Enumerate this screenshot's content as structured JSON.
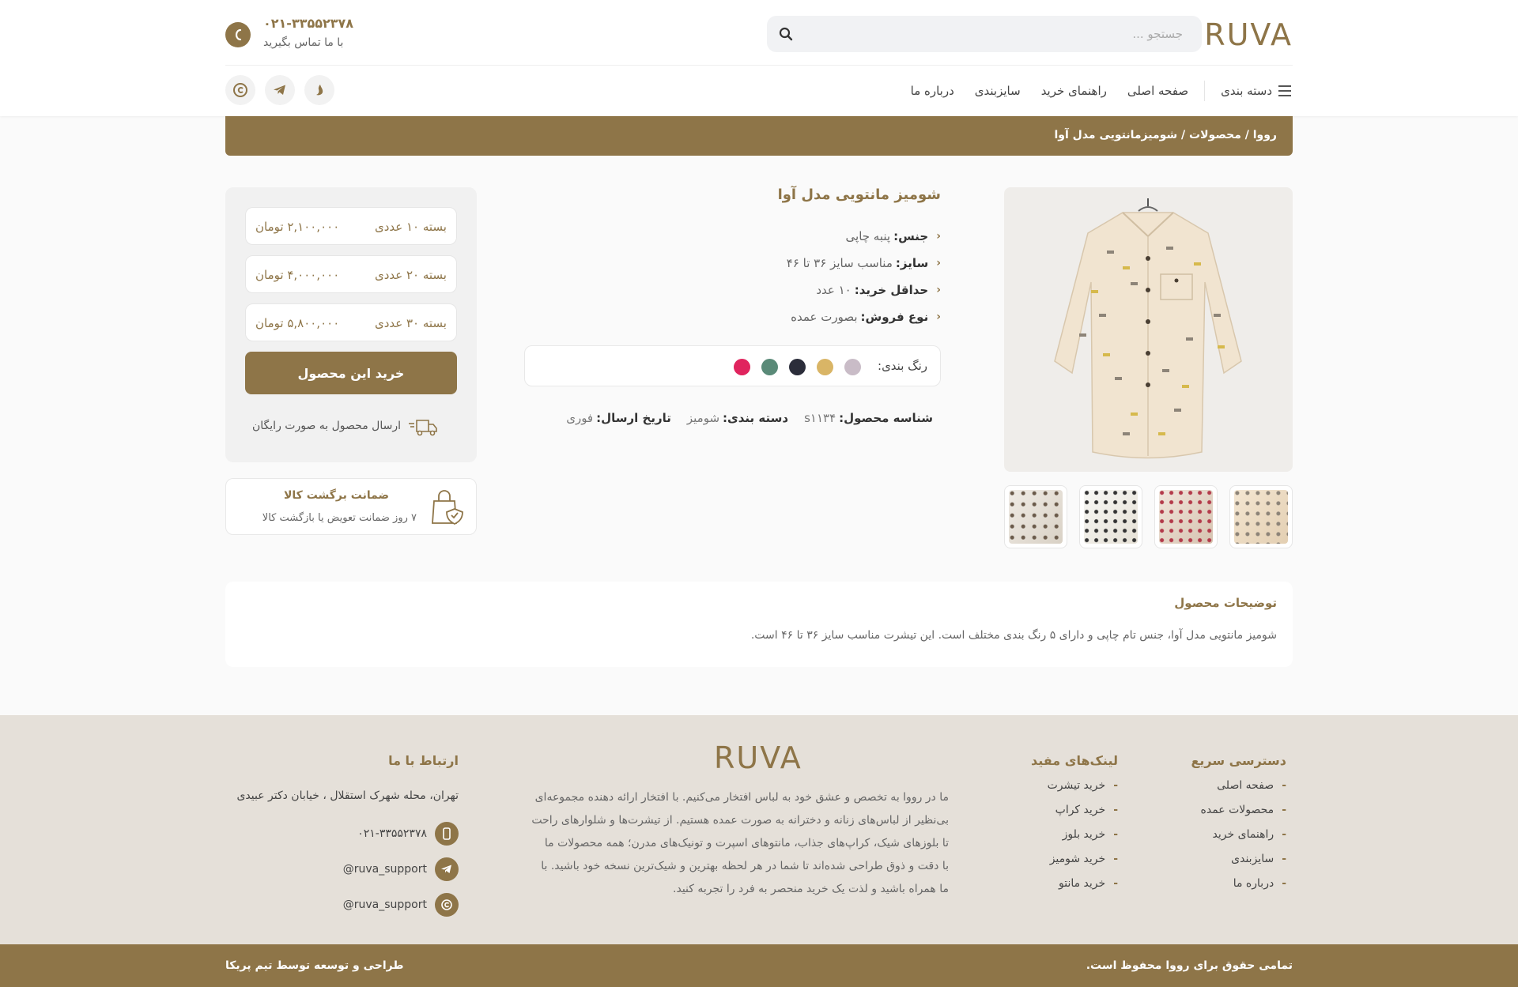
{
  "header": {
    "logo": "RUVA",
    "search_placeholder": "جستجو ...",
    "contact_phone": "۰۲۱-۳۳۵۵۲۳۷۸",
    "contact_label": "با ما تماس بگیرید"
  },
  "nav": {
    "categories": "دسته بندی",
    "items": [
      "صفحه اصلی",
      "راهنمای خرید",
      "سایزبندی",
      "درباره ما"
    ]
  },
  "socials": [
    "eitaa-icon",
    "telegram-icon",
    "bale-icon"
  ],
  "breadcrumb": "رووا / محصولات / شومیزمانتویی مدل آوا",
  "product": {
    "title": "شومیز مانتویی مدل آوا",
    "specs": [
      {
        "key": "جنس:",
        "value": "پنبه چاپی"
      },
      {
        "key": "سایز:",
        "value": "مناسب سایز ۳۶ تا ۴۶"
      },
      {
        "key": "حداقل خرید:",
        "value": "۱۰ عدد"
      },
      {
        "key": "نوع فروش:",
        "value": "بصورت عمده"
      }
    ],
    "colors_label": "رنگ بندی:",
    "colors": [
      "#c9bcc7",
      "#d9b566",
      "#2b2d3a",
      "#5a8a78",
      "#e0245e"
    ],
    "meta": {
      "id_label": "شناسه محصول:",
      "id_value": "s۱۱۳۴",
      "cat_label": "دسته بندی:",
      "cat_value": "شومیز",
      "ship_label": "تاریخ ارسال:",
      "ship_value": "فوری"
    }
  },
  "packs": [
    {
      "label": "بسته ۱۰ عددی",
      "price": "۲,۱۰۰,۰۰۰ تومان"
    },
    {
      "label": "بسته ۲۰ عددی",
      "price": "۴,۰۰۰,۰۰۰ تومان"
    },
    {
      "label": "بسته ۳۰ عددی",
      "price": "۵,۸۰۰,۰۰۰ تومان"
    }
  ],
  "buy_label": "خرید این محصول",
  "free_shipping": "ارسال محصول به صورت رایگان",
  "guarantee": {
    "title": "ضمانت برگشت کالا",
    "text": "۷ روز ضمانت تعویض یا بازگشت کالا"
  },
  "description": {
    "title": "توضیحات محصول",
    "text": "شومیز مانتویی مدل آوا، جنس تام چاپی و دارای ۵ رنگ بندی مختلف است. این تیشرت مناسب سایز ۳۶ تا ۴۶ است."
  },
  "footer": {
    "quick_title": "دسترسی سریع",
    "quick_links": [
      "صفحه اصلی",
      "محصولات عمده",
      "راهنمای خرید",
      "سایزبندی",
      "درباره ما"
    ],
    "useful_title": "لینک‌های مفید",
    "useful_links": [
      "خرید تیشرت",
      "خرید کراپ",
      "خرید بلوز",
      "خرید شومیز",
      "خرید مانتو"
    ],
    "logo": "RUVA",
    "about_lines": [
      "ما در رووا به تخصص و عشق خود به لباس افتخار می‌کنیم. با افتخار ارائه دهنده مجموعه‌ای",
      "بی‌نظیر از لباس‌های زنانه و دخترانه به صورت عمده هستیم. از تیشرت‌ها و شلوارهای راحت",
      "تا بلوزهای شیک، کراپ‌های جذاب، مانتوهای اسپرت و تونیک‌های مدرن؛ همه محصولات ما",
      "با دقت و ذوق طراحی شده‌اند تا شما در هر لحظه بهترین و شیک‌ترین نسخه خود باشید. با",
      "ما همراه باشید و لذت یک خرید منحصر به فرد را تجربه کنید."
    ],
    "contact_title": "ارتباط با ما",
    "address": "تهران، محله شهرک استقلال ، خیابان دکتر عبیدی",
    "phone": "۰۲۱-۳۳۵۵۲۳۷۸",
    "telegram": "@ruva_support",
    "eitaa": "@ruva_support",
    "copyright": "تمامی حقوق برای رووا محفوظ است.",
    "credit": "طراحی و توسعه توسط تیم پریکا"
  }
}
